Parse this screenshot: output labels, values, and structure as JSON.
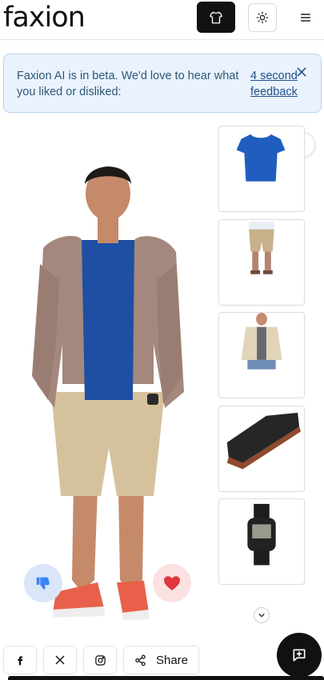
{
  "header": {
    "logo": "faxion",
    "icons": [
      "shirt-icon",
      "sun-icon",
      "menu-icon"
    ]
  },
  "banner": {
    "message": "Faxion AI is in beta. We'd love to hear what you liked or disliked:",
    "link_text": "4 second feedback"
  },
  "thumbnails": [
    {
      "name": "blue-tshirt"
    },
    {
      "name": "khaki-shorts"
    },
    {
      "name": "beige-jacket"
    },
    {
      "name": "black-sneakers"
    },
    {
      "name": "black-digital-watch"
    }
  ],
  "share": {
    "label": "Share",
    "social_icons": [
      "facebook-icon",
      "x-icon",
      "instagram-icon",
      "share-icon"
    ]
  },
  "colors": {
    "accent": "#111111",
    "banner_bg": "#eaf3fd",
    "dislike_bg": "#d9e6f8",
    "love_bg": "#fbe1e1",
    "heart": "#e0363e",
    "thumb_down": "#3b82f6"
  }
}
